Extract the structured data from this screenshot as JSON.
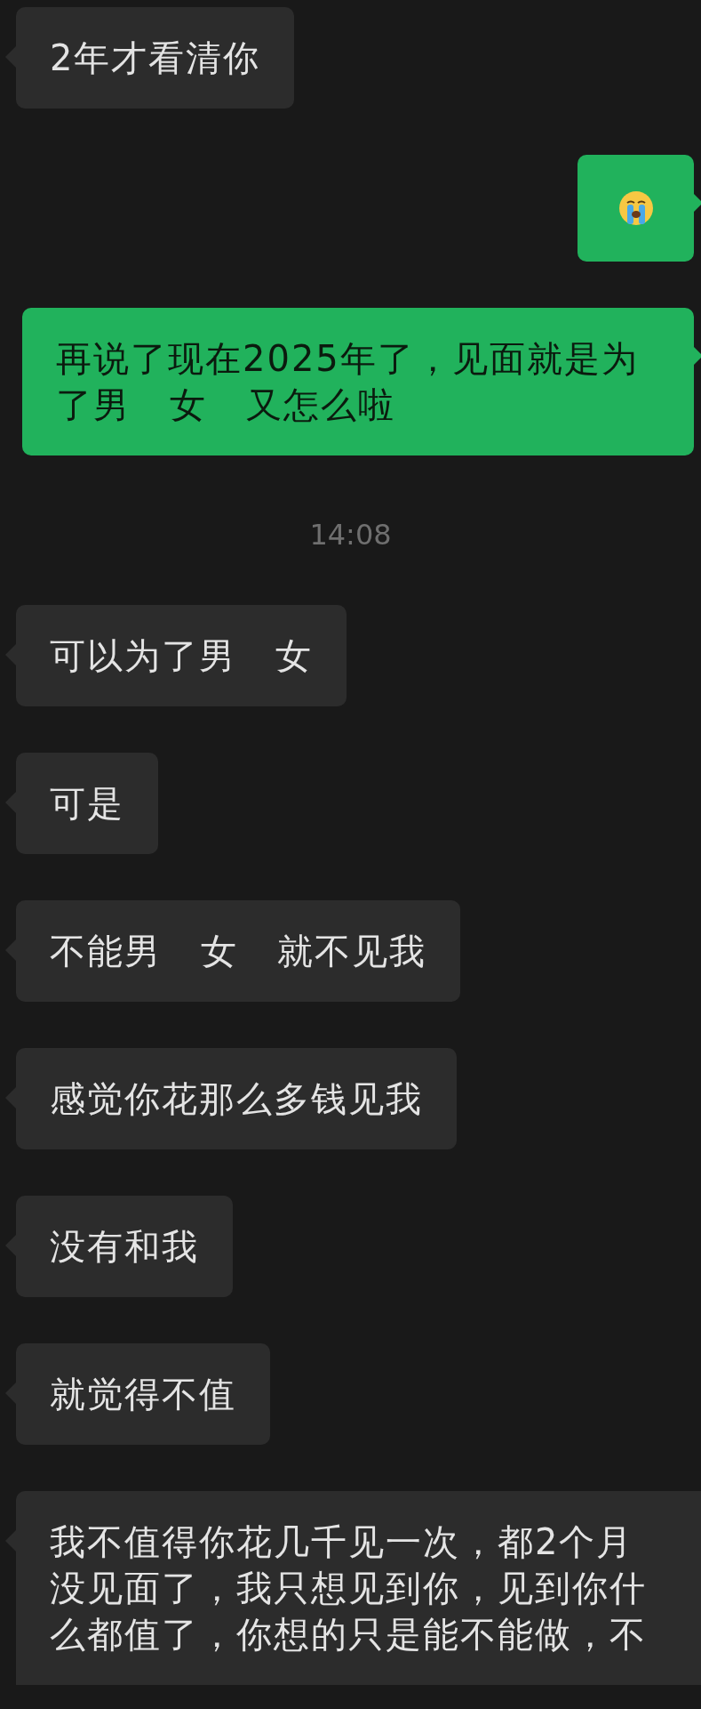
{
  "messages": [
    {
      "kind": "received",
      "text": "2年才看清你"
    },
    {
      "kind": "sent-emoji"
    },
    {
      "kind": "sent",
      "text": "再说了现在2025年了，见面就是为了男   女   又怎么啦"
    },
    {
      "kind": "time",
      "text": "14:08"
    },
    {
      "kind": "received",
      "text": "可以为了男   女"
    },
    {
      "kind": "received",
      "text": "可是"
    },
    {
      "kind": "received",
      "text": "不能男   女   就不见我"
    },
    {
      "kind": "received",
      "text": "感觉你花那么多钱见我"
    },
    {
      "kind": "received",
      "text": "没有和我"
    },
    {
      "kind": "received",
      "text": "就觉得不值"
    },
    {
      "kind": "received-cut",
      "text": "我不值得你花几千见一次，都2个月没见面了，我只想见到你，见到你什么都值了，你想的只是能不能做，不"
    }
  ]
}
